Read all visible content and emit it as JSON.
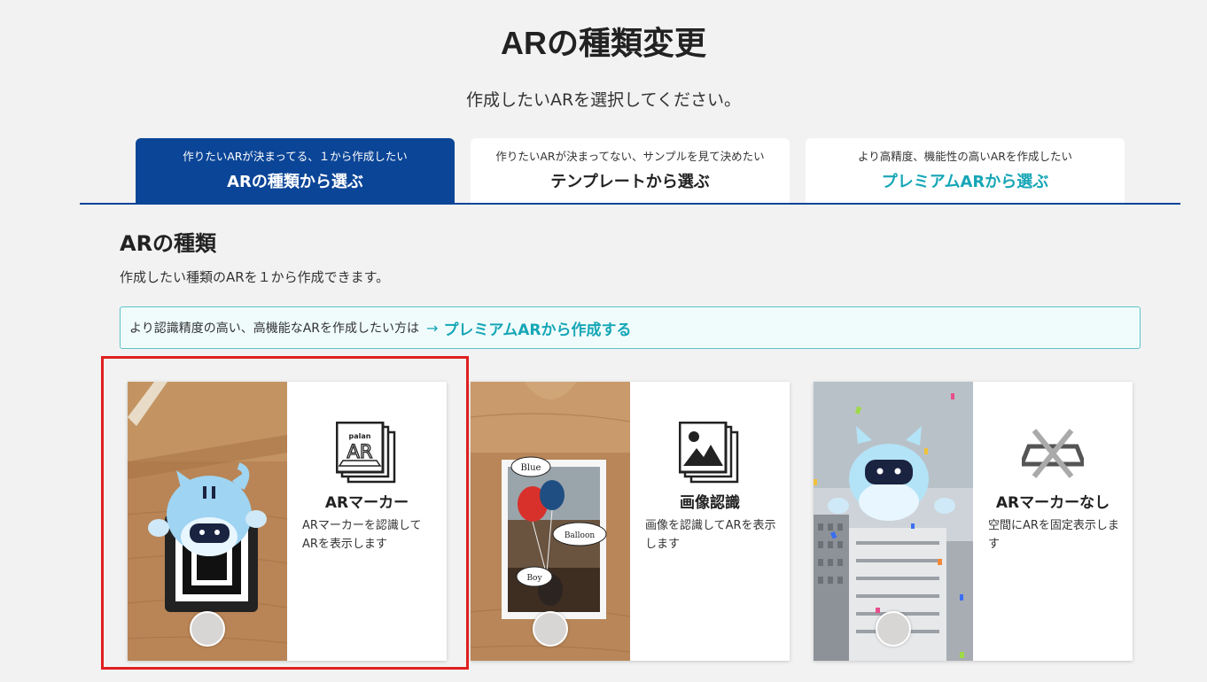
{
  "page": {
    "title": "ARの種類変更",
    "subtitle": "作成したいARを選択してください。"
  },
  "tabs": [
    {
      "sub": "作りたいARが決まってる、１から作成したい",
      "label": "ARの種類から選ぶ",
      "active": true
    },
    {
      "sub": "作りたいARが決まってない、サンプルを見て決めたい",
      "label": "テンプレートから選ぶ",
      "active": false
    },
    {
      "sub": "より高精度、機能性の高いARを作成したい",
      "label": "プレミアムARから選ぶ",
      "active": false
    }
  ],
  "section": {
    "title": "ARの種類",
    "desc": "作成したい種類のARを１から作成できます。"
  },
  "notice": {
    "text": "より認識精度の高い、高機能なARを作成したい方は",
    "arrow": "→",
    "link": "プレミアムARから作成する"
  },
  "cards": [
    {
      "title": "ARマーカー",
      "desc": "ARマーカーを認識してARを表示します",
      "icon": "palan-ar-marker-icon",
      "icon_text": {
        "small": "palan",
        "big": "AR"
      },
      "selected": true
    },
    {
      "title": "画像認識",
      "desc": "画像を認識してARを表示します",
      "icon": "image-recognition-icon",
      "photo_labels": [
        "Blue",
        "Balloon",
        "Boy"
      ],
      "selected": false
    },
    {
      "title": "ARマーカーなし",
      "desc": "空間にARを固定表示します",
      "icon": "no-marker-icon",
      "selected": false
    }
  ],
  "colors": {
    "primary": "#0b4597",
    "accent": "#16a6b6",
    "selection": "#e02020",
    "notice_bg": "#f0fcfc",
    "page_bg": "#f2f2f2"
  }
}
